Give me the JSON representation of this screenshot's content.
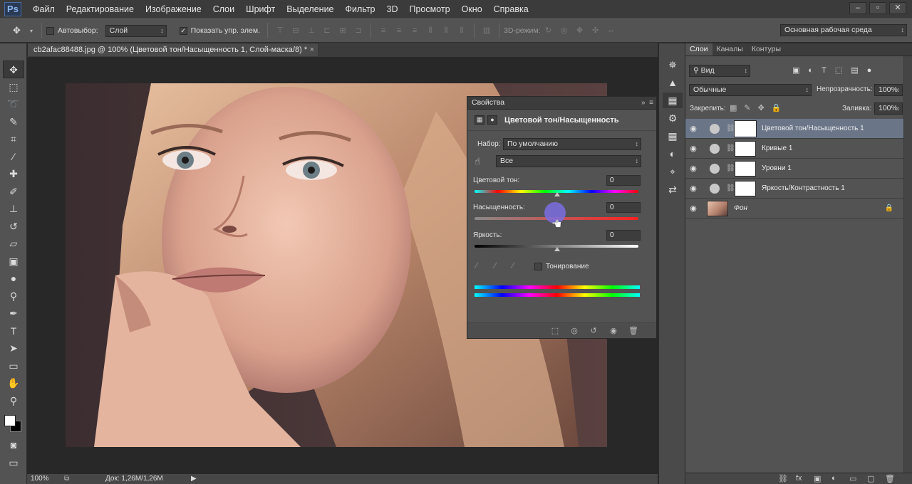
{
  "app": {
    "logo": "Ps"
  },
  "menu": [
    "Файл",
    "Редактирование",
    "Изображение",
    "Слои",
    "Шрифт",
    "Выделение",
    "Фильтр",
    "3D",
    "Просмотр",
    "Окно",
    "Справка"
  ],
  "window_controls": {
    "minimize": "–",
    "restore": "▫",
    "close": "✕"
  },
  "options_bar": {
    "move_icon": "move-tool-icon",
    "autoselect_label": "Автовыбор:",
    "autoselect_value": "Слой",
    "show_controls_label": "Показать упр. элем.",
    "show_controls_checked": "✓",
    "mode_3d_label": "3D-режим:",
    "workspace": "Основная рабочая среда"
  },
  "document": {
    "tab_title": "cb2afac88488.jpg @ 100% (Цветовой тон/Насыщенность 1, Слой-маска/8) *",
    "tab_close": "×",
    "zoom": "100%",
    "doc_info": "Док: 1,26M/1,26M"
  },
  "properties": {
    "panel_title": "Свойства",
    "adjustment_title": "Цветовой тон/Насыщенность",
    "preset_label": "Набор:",
    "preset_value": "По умолчанию",
    "channel_value": "Все",
    "hue_label": "Цветовой тон:",
    "hue_value": "0",
    "saturation_label": "Насыщенность:",
    "saturation_value": "0",
    "lightness_label": "Яркость:",
    "lightness_value": "0",
    "colorize_label": "Тонирование"
  },
  "layers_panel": {
    "tabs": [
      "Слои",
      "Каналы",
      "Контуры"
    ],
    "filter_value": "Вид",
    "blend_mode": "Обычные",
    "opacity_label": "Непрозрачность:",
    "opacity_value": "100%",
    "lock_label": "Закрепить:",
    "fill_label": "Заливка:",
    "fill_value": "100%",
    "layers": [
      {
        "name": "Цветовой тон/Насыщенность 1",
        "selected": true
      },
      {
        "name": "Кривые 1"
      },
      {
        "name": "Уровни 1"
      },
      {
        "name": "Яркость/Контрастность 1"
      },
      {
        "name": "Фон"
      }
    ]
  },
  "colors": {
    "panel_bg": "#535353",
    "canvas_bg": "#282828",
    "selection": "#6a7588",
    "cursor_highlight": "#7b6fe0"
  }
}
